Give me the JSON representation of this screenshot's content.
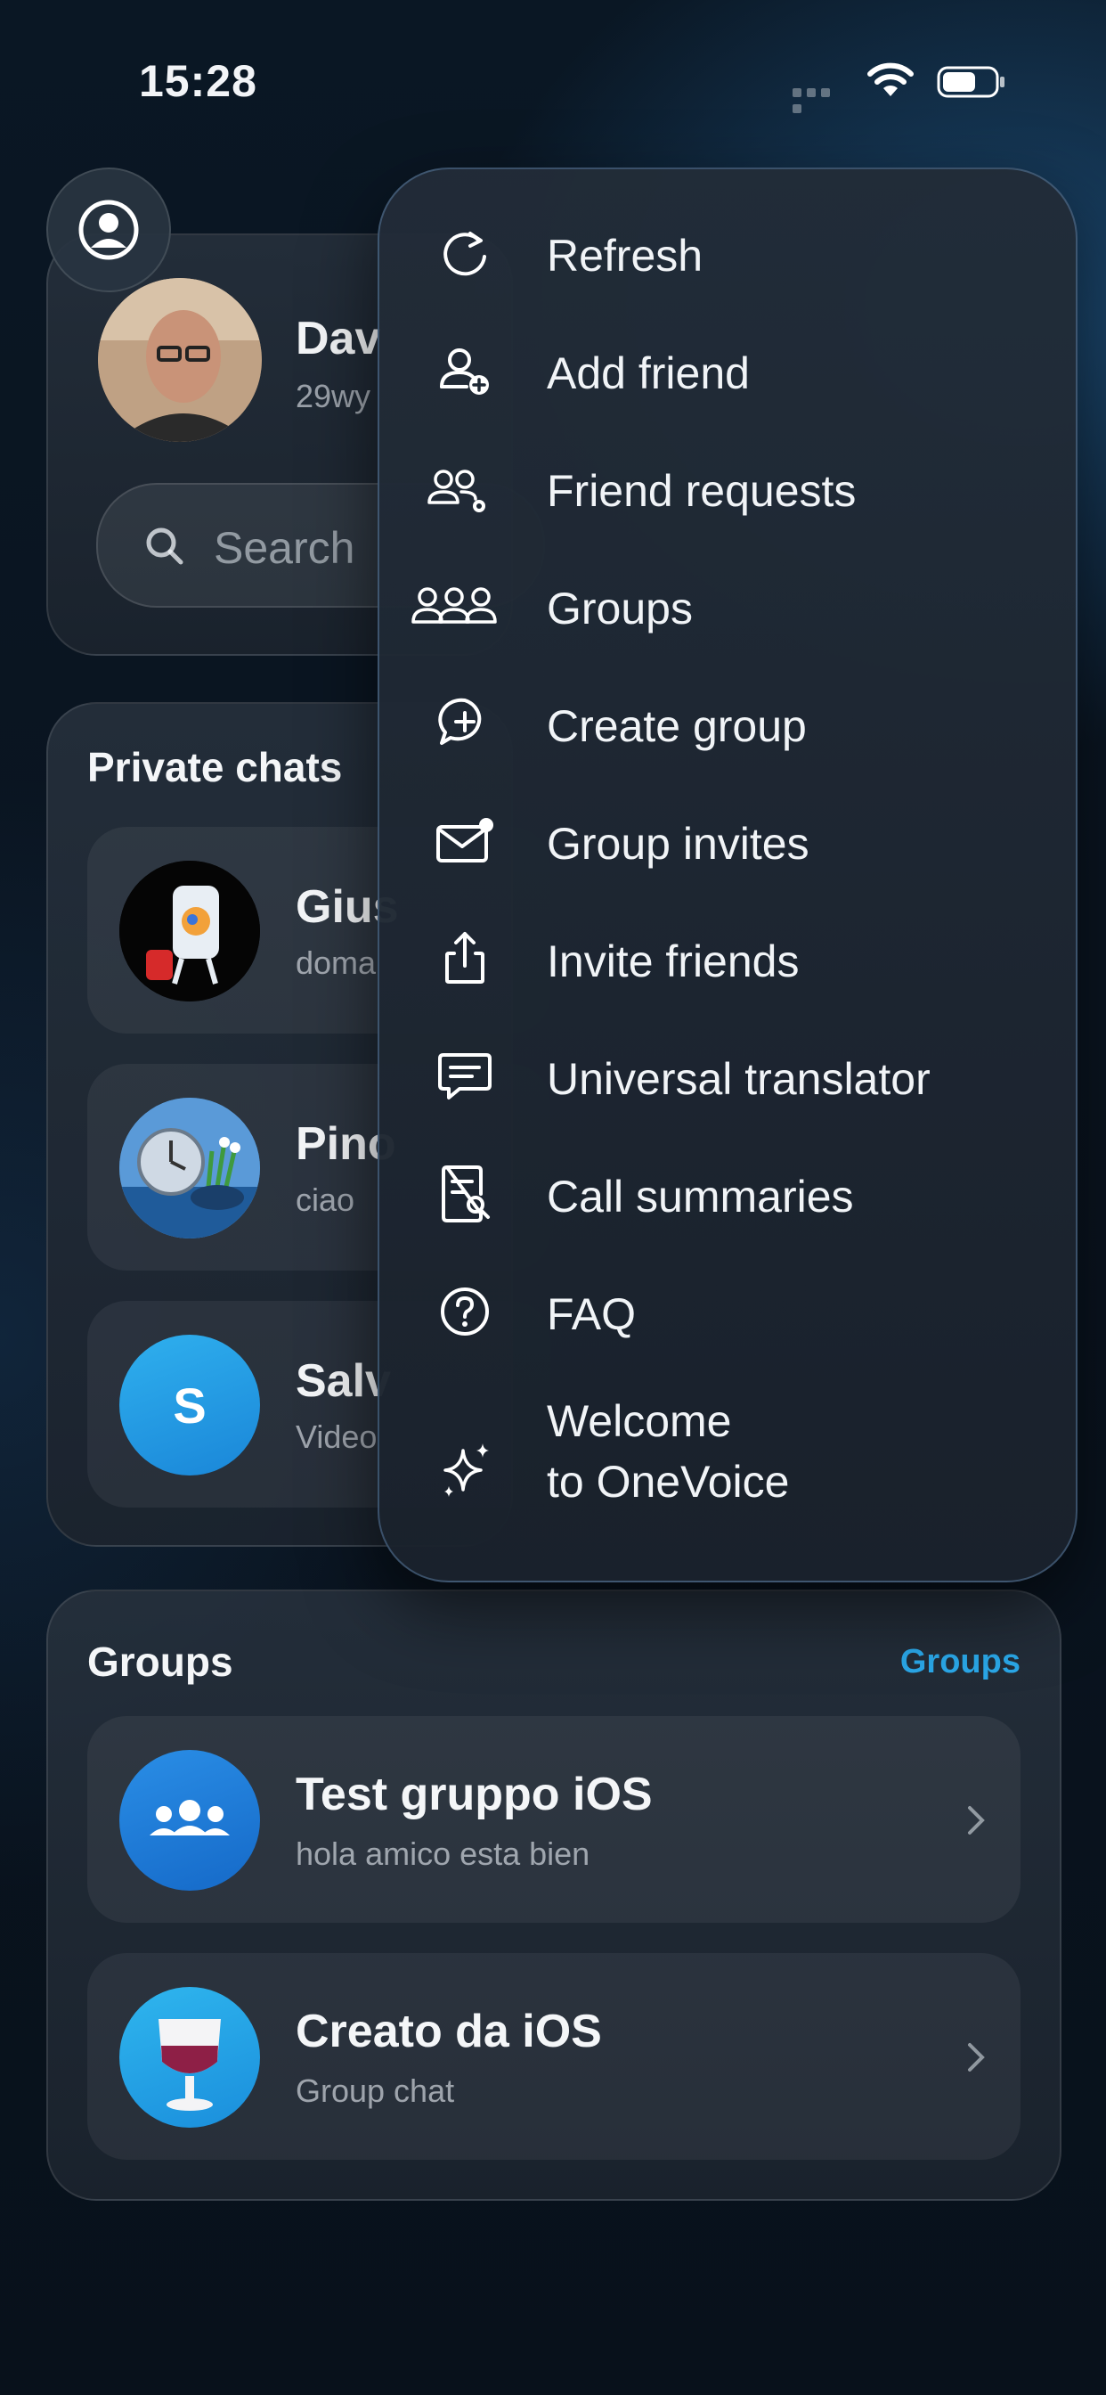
{
  "status_bar": {
    "time": "15:28"
  },
  "profile": {
    "name": "Dav",
    "id_text": "29wy",
    "search_placeholder": "Search"
  },
  "private_chats": {
    "title": "Private chats",
    "items": [
      {
        "name": "Gius",
        "preview": "doma"
      },
      {
        "name": "Pino",
        "preview": "ciao"
      },
      {
        "name": "Salv",
        "preview": "Video",
        "initial": "S"
      }
    ]
  },
  "groups": {
    "title": "Groups",
    "link": "Groups",
    "items": [
      {
        "name": "Test gruppo iOS",
        "preview": "hola amico esta bien"
      },
      {
        "name": "Creato da iOS",
        "preview": "Group chat"
      }
    ]
  },
  "menu": {
    "items": [
      {
        "label": "Refresh",
        "icon": "refresh-icon"
      },
      {
        "label": "Add friend",
        "icon": "add-friend-icon"
      },
      {
        "label": "Friend requests",
        "icon": "friend-requests-icon"
      },
      {
        "label": "Groups",
        "icon": "groups-icon"
      },
      {
        "label": "Create group",
        "icon": "create-group-icon"
      },
      {
        "label": "Group invites",
        "icon": "group-invites-icon"
      },
      {
        "label": "Invite friends",
        "icon": "share-icon"
      },
      {
        "label": "Universal translator",
        "icon": "translator-icon"
      },
      {
        "label": "Call summaries",
        "icon": "call-summaries-icon"
      },
      {
        "label": "FAQ",
        "icon": "faq-icon"
      },
      {
        "label_line1": "Welcome",
        "label_line2": "to OneVoice",
        "icon": "sparkles-icon"
      }
    ]
  },
  "colors": {
    "accent": "#2aa7e8",
    "avatar_blue": "#1e8fe0",
    "menu_border": "#7aaadc"
  }
}
